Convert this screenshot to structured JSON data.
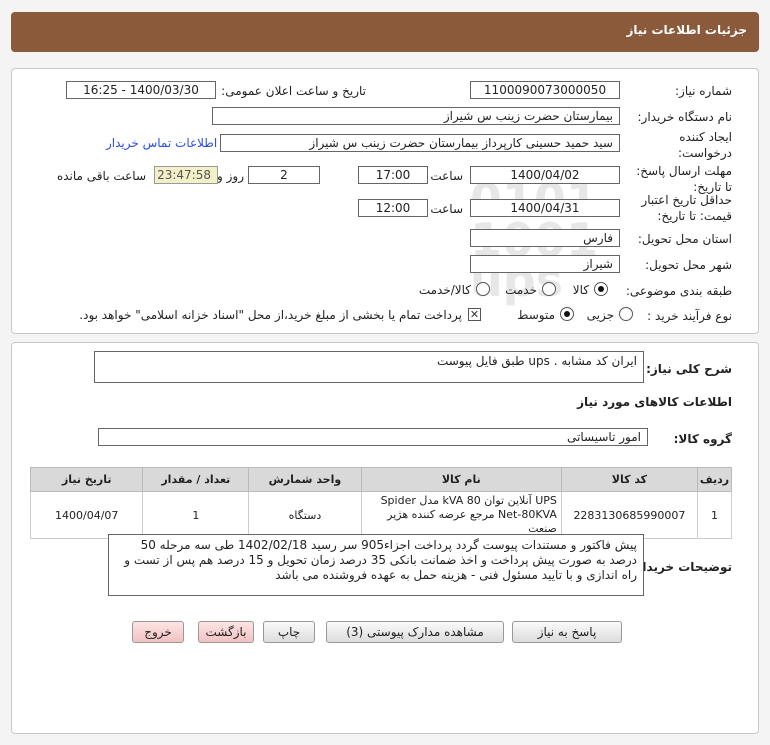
{
  "header": {
    "title": "جزئیات اطلاعات نیاز"
  },
  "fields": {
    "need_number_label": "شماره نیاز:",
    "need_number": "1100090073000050",
    "announce_label": "تاریخ و ساعت اعلان عمومی:",
    "announce_value": "1400/03/30 - 16:25",
    "buyer_label": "نام دستگاه خریدار:",
    "buyer_value": "بیمارستان حضرت زینب  س  شیراز",
    "creator_label_1": "ایجاد کننده",
    "creator_label_2": "درخواست:",
    "creator_value": "سید حمید حسینی کارپرداز بیمارستان حضرت زینب  س  شیراز",
    "contact_link": "اطلاعات تماس خریدار",
    "reply_deadline_label_1": "مهلت ارسال پاسخ:",
    "reply_deadline_label_2": "تا تاریخ:",
    "reply_date": "1400/04/02",
    "time_label": "ساعت",
    "reply_time": "17:00",
    "days_value": "2",
    "days_label": "روز و",
    "remaining_time": "23:47:58",
    "remaining_label": "ساعت باقی مانده",
    "validity_label_1": "حداقل تاریخ اعتبار",
    "validity_label_2": "قیمت: تا تاریخ:",
    "validity_date": "1400/04/31",
    "validity_time": "12:00",
    "province_label": "استان محل تحویل:",
    "province_value": "فارس",
    "city_label": "شهر محل تحویل:",
    "city_value": "شیراز",
    "category_label": "طبقه بندی موضوعی:",
    "category_options": [
      "کالا",
      "خدمت",
      "کالا/خدمت"
    ],
    "process_label": "نوع فرآیند خرید :",
    "process_options": [
      "جزیی",
      "متوسط"
    ],
    "payment_note": "پرداخت تمام یا بخشی از مبلغ خرید،از محل \"اسناد خزانه اسلامی\" خواهد بود."
  },
  "description": {
    "label": "شرح کلی نیاز:",
    "value": "ایران کد مشابه . ups طبق فایل پیوست"
  },
  "goods": {
    "section_title": "اطلاعات کالاهای مورد نیاز",
    "group_label": "گروه کالا:",
    "group_value": "امور تاسیساتی",
    "columns": [
      "ردیف",
      "کد کالا",
      "نام کالا",
      "واحد شمارش",
      "تعداد / مقدار",
      "تاریخ نیاز"
    ],
    "rows": [
      {
        "row": "1",
        "code": "2283130685990007",
        "name": "UPS آنلاین توان kVA 80 مدل Spider Net-80KVA مرجع عرضه کننده هژیر صنعت",
        "unit": "دستگاه",
        "qty": "1",
        "date": "1400/04/07"
      }
    ]
  },
  "buyer_notes": {
    "label": "توضیحات خریدار:",
    "value": "پیش فاکتور و مستندات پیوست گردد پرداخت اجزاء905 سر رسید 1402/02/18 طی سه مرحله 50 درصد به صورت پیش پرداخت و اخذ ضمانت بانکی 35 درصد زمان تحویل و 15 درصد هم پس از تست و راه اندازی و با تایید مسئول فنی - هزینه حمل به عهده فروشنده می باشد"
  },
  "buttons": {
    "reply": "پاسخ به نیاز",
    "attachments": "مشاهده مدارک پیوستی (3)",
    "print": "چاپ",
    "back": "بازگشت",
    "exit": "خروج"
  },
  "watermark": {
    "brand": "ParsNamadData"
  }
}
